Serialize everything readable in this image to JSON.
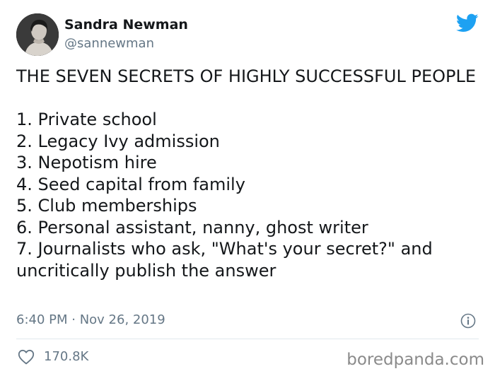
{
  "author": {
    "display_name": "Sandra Newman",
    "handle": "@sannewman",
    "avatar_icon": "profile-photo"
  },
  "brand": {
    "icon": "twitter-bird-icon",
    "color": "#1da1f2"
  },
  "tweet": {
    "title": "THE SEVEN SECRETS OF HIGHLY SUCCESSFUL PEOPLE",
    "items": [
      "1. Private school",
      "2. Legacy Ivy admission",
      "3. Nepotism hire",
      "4. Seed capital from family",
      "5. Club memberships",
      "6. Personal assistant, nanny, ghost writer",
      "7. Journalists who ask, \"What's your secret?\" and uncritically publish the answer"
    ],
    "timestamp": "6:40 PM · Nov 26, 2019"
  },
  "engagement": {
    "likes": "170.8K"
  },
  "watermark": "boredpanda.com",
  "colors": {
    "text": "#14171a",
    "muted": "#657786",
    "divider": "#e1e8ed"
  }
}
